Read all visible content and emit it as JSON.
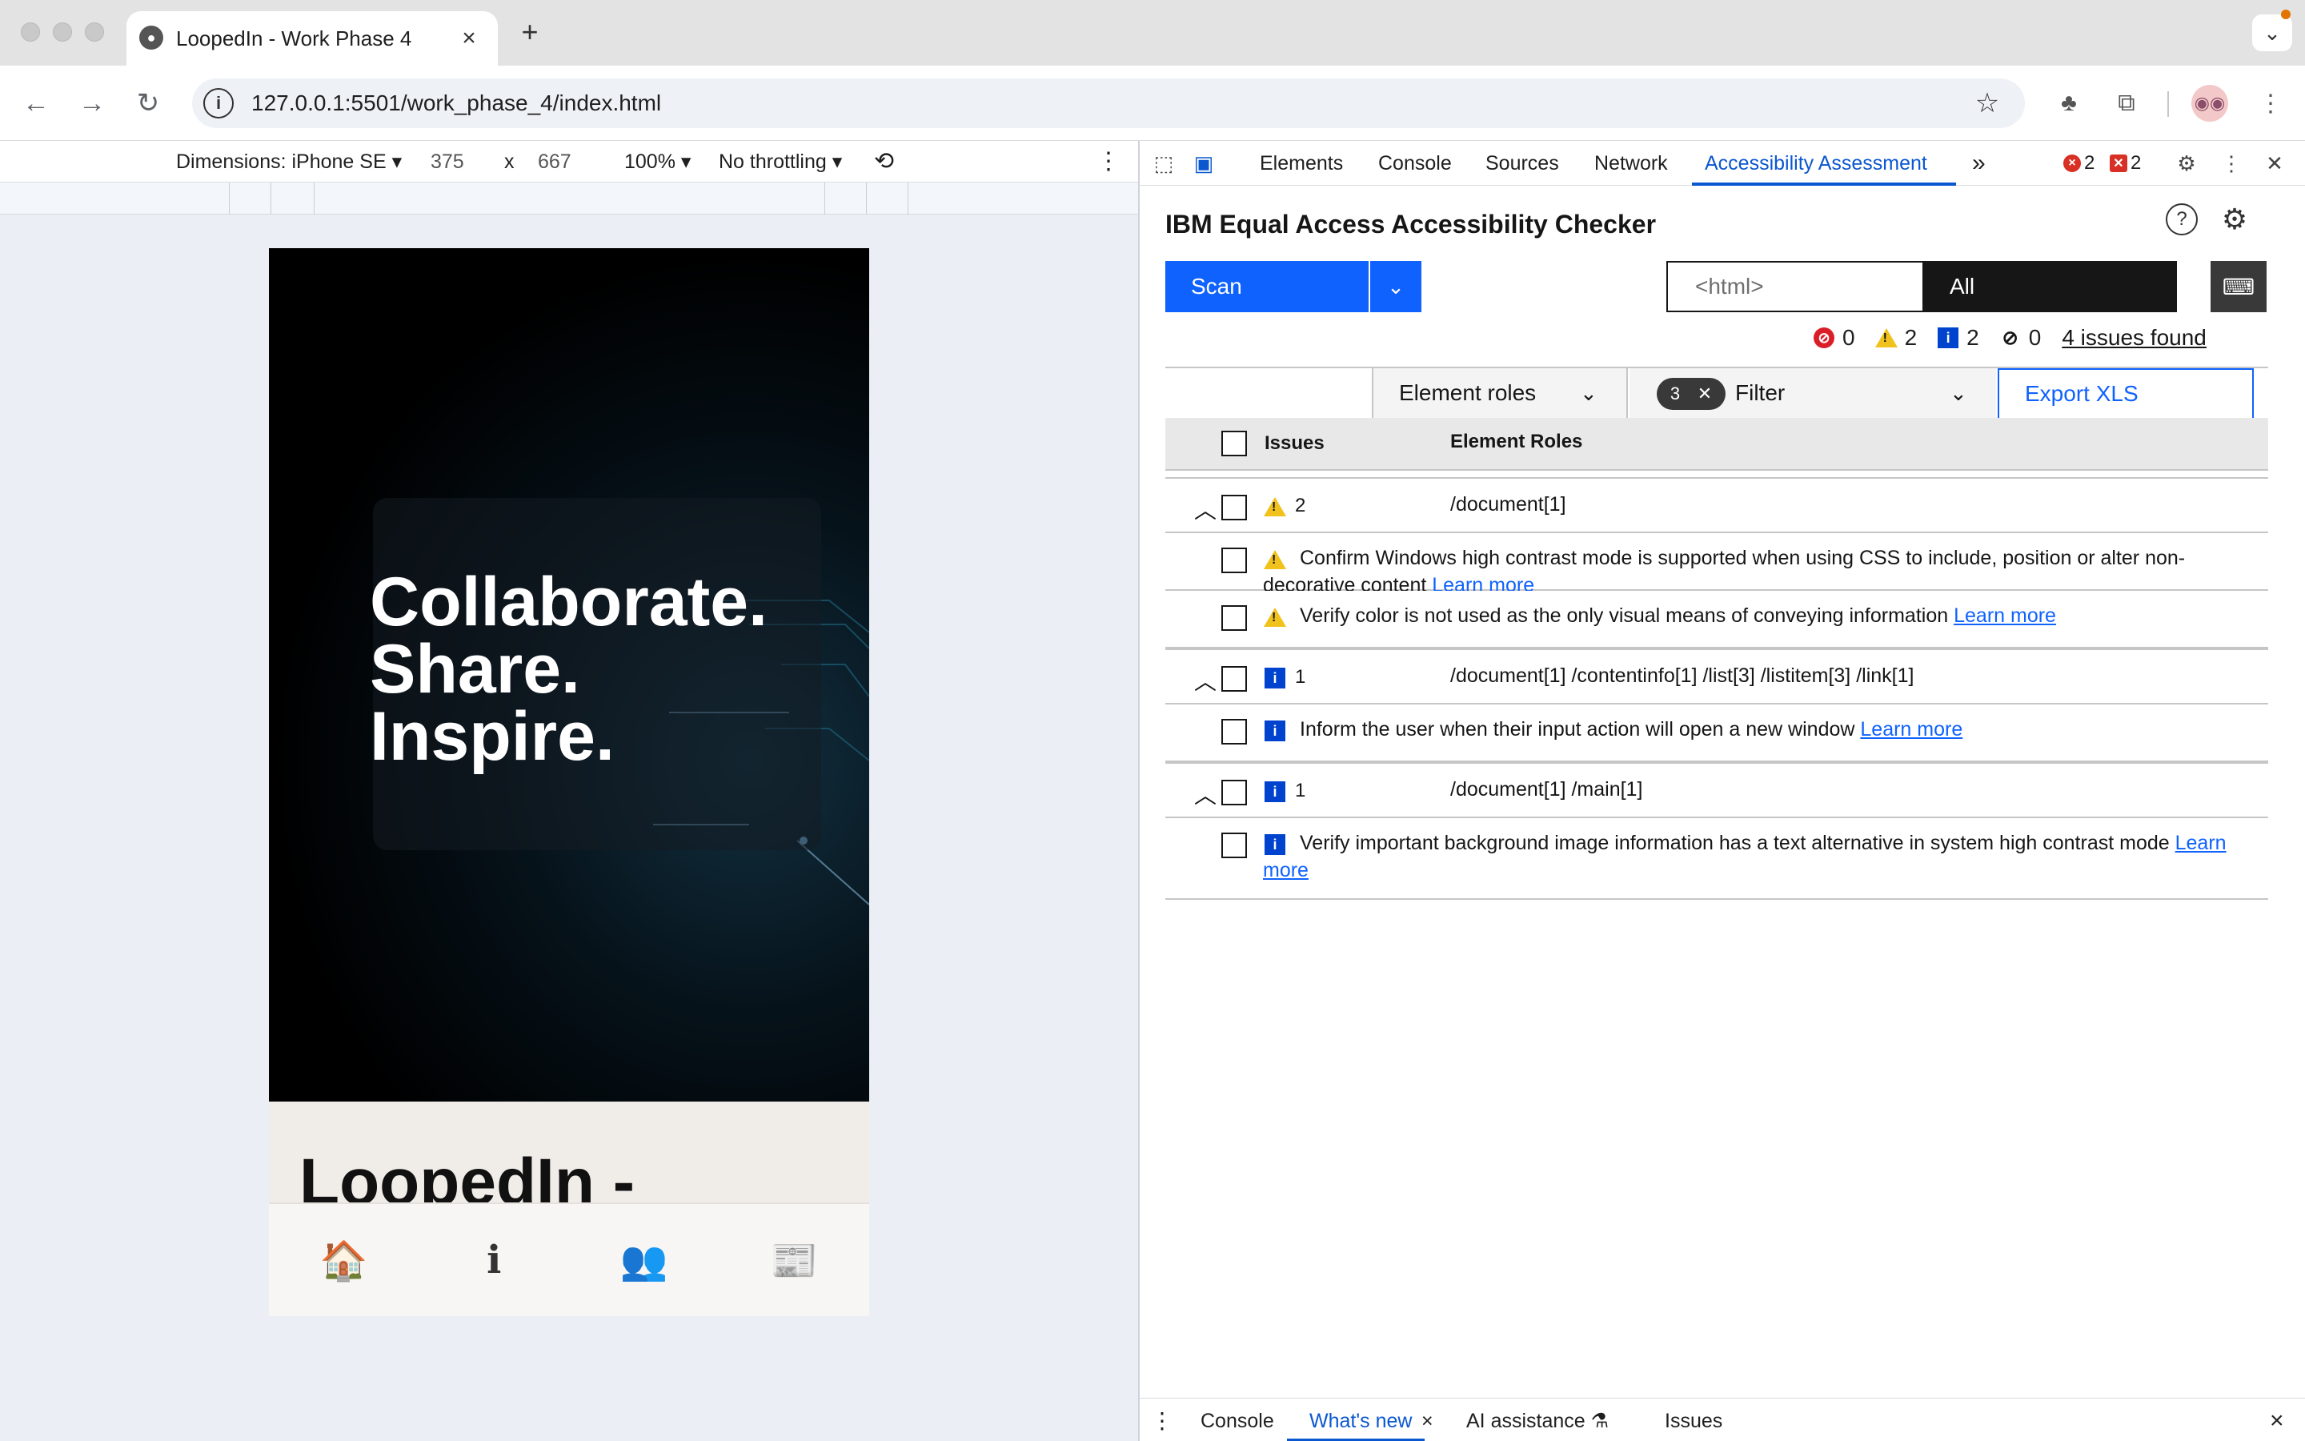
{
  "browser": {
    "tab_title": "LoopedIn - Work Phase 4",
    "url": "127.0.0.1:5501/work_phase_4/index.html",
    "new_tab_icon": "plus-icon",
    "close_icon": "close-icon"
  },
  "device_toolbar": {
    "dimensions_label": "Dimensions: iPhone SE",
    "width": "375",
    "times": "x",
    "height": "667",
    "zoom": "100%",
    "throttling": "No throttling"
  },
  "page": {
    "hero_lines": [
      "Collaborate.",
      "Share.",
      "Inspire."
    ],
    "heading": "LoopedIn -",
    "bottom_nav": [
      "🏠",
      "ℹ",
      "👥",
      "📰"
    ]
  },
  "devtools": {
    "tabs": [
      "Elements",
      "Console",
      "Sources",
      "Network",
      "Accessibility Assessment"
    ],
    "more": "»",
    "error_count": "2",
    "issue_count": "2"
  },
  "checker": {
    "title": "IBM Equal Access Accessibility Checker",
    "scan_label": "Scan",
    "scope_placeholder": "<html>",
    "scope_value": "All",
    "counts": {
      "violations": "0",
      "needs_review": "2",
      "recommendations": "2",
      "hidden": "0"
    },
    "issues_found": "4 issues found",
    "view_by": "Element roles",
    "filter_tag_count": "3",
    "filter_label": "Filter",
    "export_label": "Export XLS",
    "col_issues": "Issues",
    "col_roles": "Element Roles",
    "groups": [
      {
        "type": "warning",
        "count": "2",
        "path": "/document[1]",
        "issues": [
          {
            "type": "warning",
            "text": "Confirm Windows high contrast mode is supported when using CSS to include, position or alter non-decorative content",
            "link": "Learn more"
          },
          {
            "type": "warning",
            "text": "Verify color is not used as the only visual means of conveying information",
            "link": "Learn more"
          }
        ]
      },
      {
        "type": "info",
        "count": "1",
        "path": "/document[1] /contentinfo[1] /list[3] /listitem[3] /link[1]",
        "issues": [
          {
            "type": "info",
            "text": "Inform the user when their input action will open a new window",
            "link": "Learn more"
          }
        ]
      },
      {
        "type": "info",
        "count": "1",
        "path": "/document[1] /main[1]",
        "issues": [
          {
            "type": "info",
            "text": "Verify important background image information has a text alternative in system high contrast mode",
            "link": "Learn more"
          }
        ]
      }
    ]
  },
  "drawer": {
    "tabs": [
      "Console",
      "What's new",
      "AI assistance",
      "Issues"
    ]
  }
}
